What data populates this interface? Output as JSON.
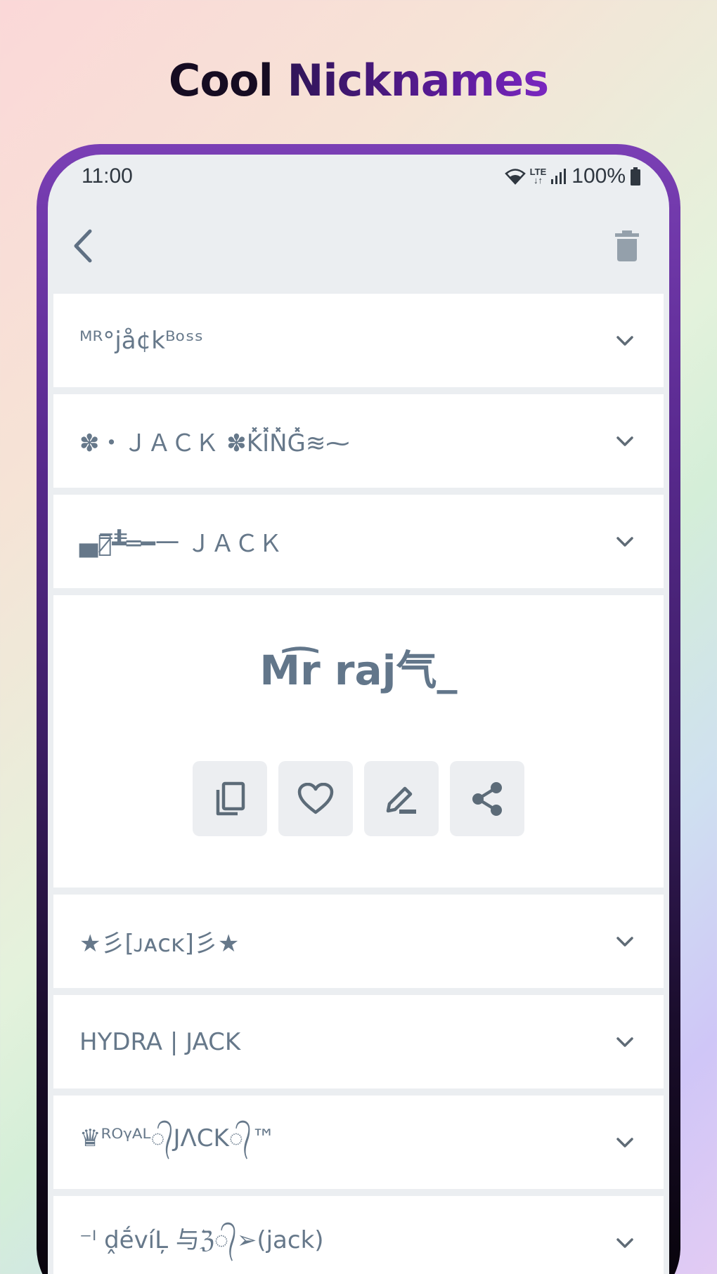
{
  "headline": {
    "word1": "Cool",
    "word2": "Nicknames"
  },
  "status_bar": {
    "time": "11:00",
    "network": "LTE",
    "battery": "100%"
  },
  "app_bar": {
    "back_icon": "chevron-left-icon",
    "delete_icon": "trash-icon"
  },
  "nicknames": [
    {
      "name": "ᴹᴿ°jå¢kᴮᵒˢˢ"
    },
    {
      "name": "✽・ＪＡＣＫ ✽K̽̽I̽̽N̽̽G̽̽≋⁓"
    },
    {
      "name": "▄︻̷̿┻̿═━一 ＪＡＣＫ"
    }
  ],
  "expanded": {
    "name": "M͡r raj气_",
    "actions": [
      {
        "icon": "copy-icon"
      },
      {
        "icon": "heart-icon"
      },
      {
        "icon": "edit-icon"
      },
      {
        "icon": "share-icon"
      }
    ]
  },
  "nicknames_after": [
    {
      "name": "★彡[ᴊᴀᴄᴋ]彡★"
    },
    {
      "name": "HYDRA | JACK"
    },
    {
      "name": "♛ᴿᴼᵞᴬᴸ᭄JΛCK᭄™"
    },
    {
      "name": "⁻ᴵ ḓḗvíĻ 与ℨ᭄➢(jack)"
    }
  ],
  "colors": {
    "accent": "#6a25b0",
    "text": "#66788a",
    "surface": "#ebeef1"
  }
}
